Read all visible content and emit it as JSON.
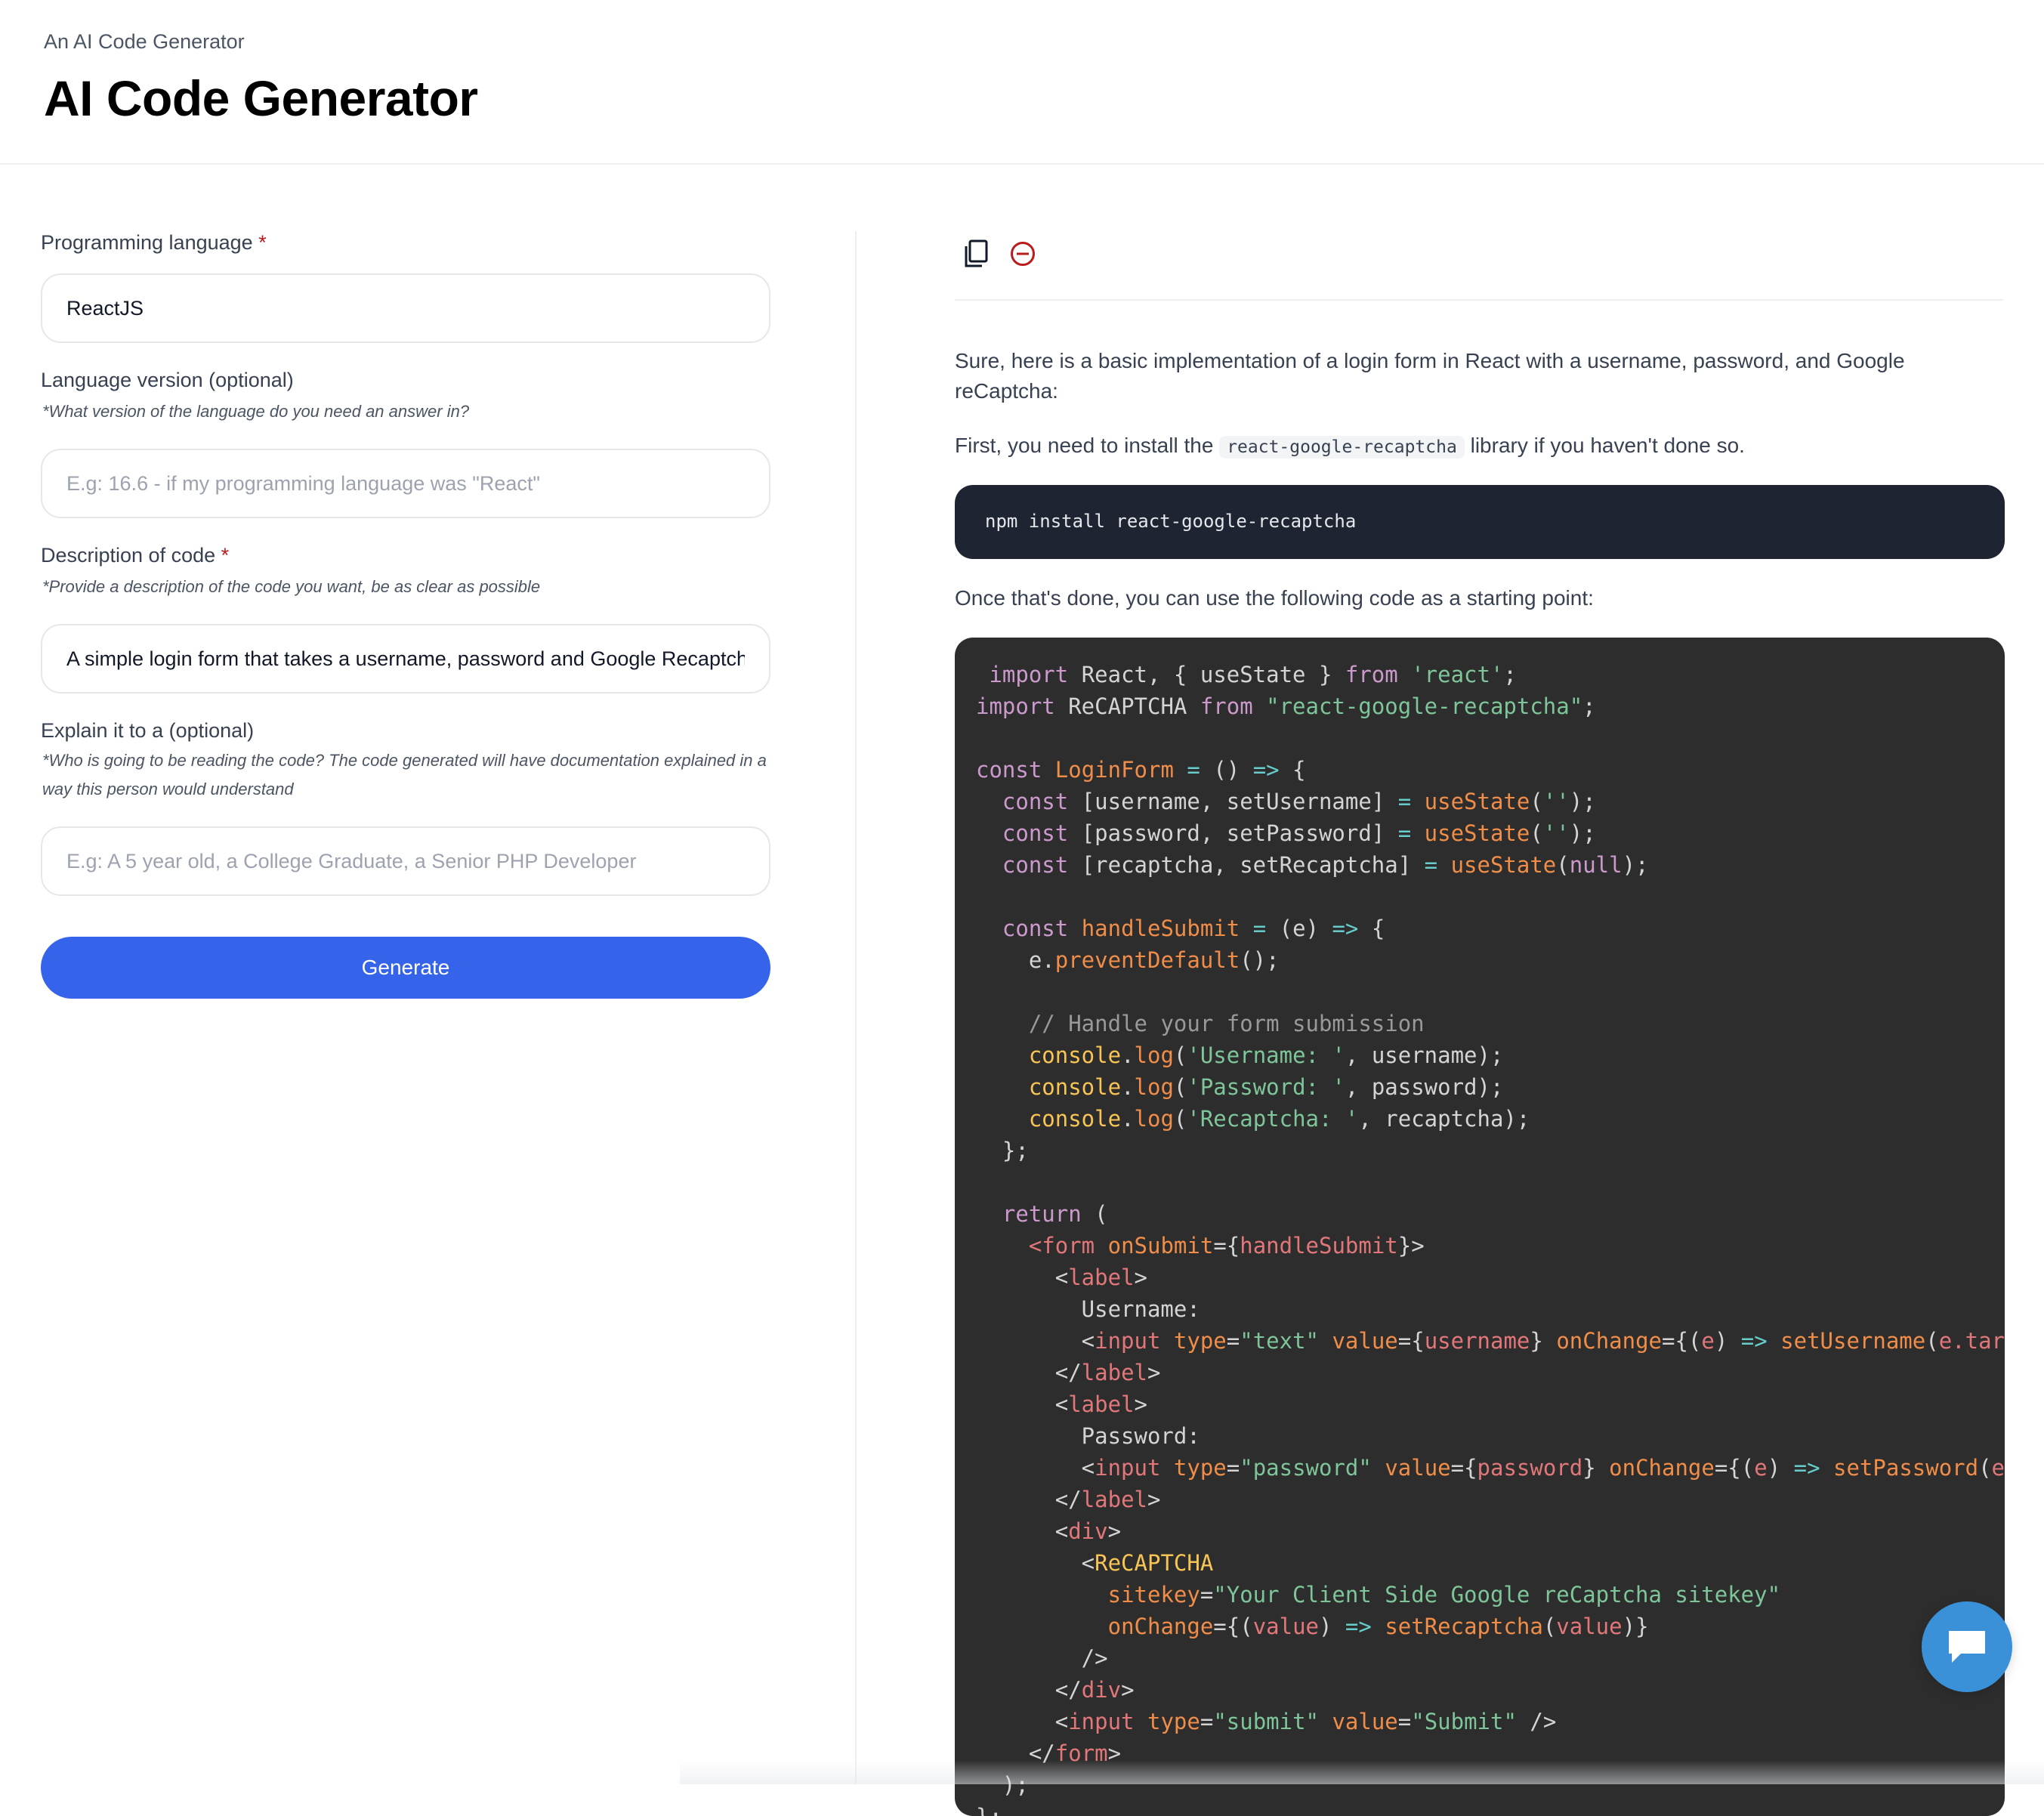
{
  "header": {
    "eyebrow": "An AI Code Generator",
    "title": "AI Code Generator"
  },
  "form": {
    "language": {
      "label": "Programming language",
      "required_mark": "*",
      "value": "ReactJS"
    },
    "version": {
      "label": "Language version (optional)",
      "hint": "*What version of the language do you need an answer in?",
      "placeholder": "E.g: 16.6 - if my programming language was \"React\"",
      "value": ""
    },
    "description": {
      "label": "Description of code",
      "required_mark": "*",
      "hint": "*Provide a description of the code you want, be as clear as possible",
      "value": "A simple login form that takes a username, password and Google Recaptcha"
    },
    "audience": {
      "label": "Explain it to a (optional)",
      "hint": "*Who is going to be reading the code? The code generated will have documentation explained in a way this person would understand",
      "placeholder": "E.g: A 5 year old, a College Graduate, a Senior PHP Developer",
      "value": ""
    },
    "generate_label": "Generate"
  },
  "output": {
    "intro": "Sure, here is a basic implementation of a login form in React with a username, password, and Google reCaptcha:",
    "install_before": "First, you need to install the ",
    "install_code": "react-google-recaptcha",
    "install_after": " library if you haven't done so.",
    "npm_command": "npm install react-google-recaptcha",
    "after_install": "Once that's done, you can use the following code as a starting point:"
  },
  "icons": {
    "copy": "copy-icon",
    "clear": "minus-circle-icon",
    "chat": "chat-bubble-icon"
  },
  "colors": {
    "accent": "#3563e9",
    "required": "#b91c1c",
    "clear_icon": "#b91c1c",
    "chat_bubble": "#3b91d8",
    "npm_block_bg": "#1f2433",
    "code_bg": "#2d2d2d"
  }
}
